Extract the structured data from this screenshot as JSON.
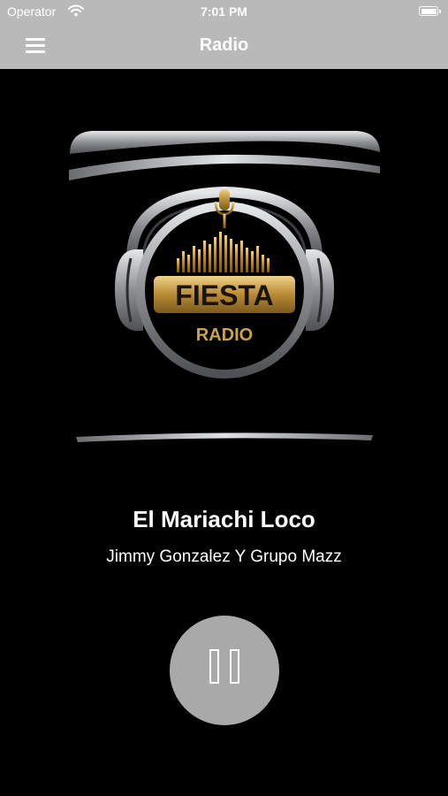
{
  "status_bar": {
    "carrier": "Operator",
    "time": "7:01 PM",
    "wifi_icon": "wifi-icon",
    "battery_icon": "battery-icon"
  },
  "nav": {
    "title": "Radio",
    "menu_icon": "hamburger-menu-icon"
  },
  "artwork": {
    "logo_word": "FIESTA",
    "logo_subword": "RADIO",
    "logo_icon": "microphone-headphones-logo"
  },
  "track": {
    "title": "El Mariachi Loco",
    "artist": "Jimmy Gonzalez Y Grupo Mazz"
  },
  "player": {
    "state_icon": "pause-icon"
  },
  "colors": {
    "header": "#b9b9b9",
    "background": "#000000",
    "gold": "#c9a24a",
    "silver": "#9a9ca0",
    "button": "#a9a9a9"
  }
}
